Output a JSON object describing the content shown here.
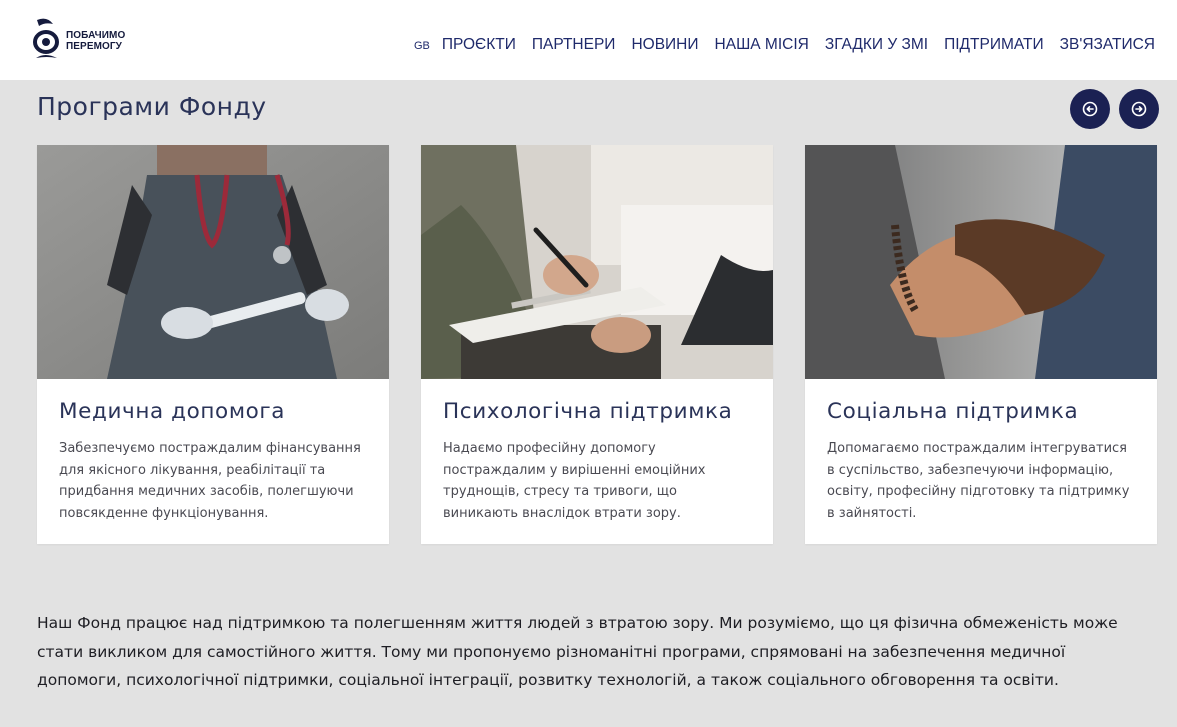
{
  "header": {
    "logo_text_line1": "ПОБАЧИМО",
    "logo_text_line2": "ПЕРЕМОГУ",
    "lang": "GB",
    "nav": [
      {
        "label": "ПРОЄКТИ"
      },
      {
        "label": "ПАРТНЕРИ"
      },
      {
        "label": "НОВИНИ"
      },
      {
        "label": "НАША МІСІЯ"
      },
      {
        "label": "ЗГАДКИ У ЗМІ"
      },
      {
        "label": "ПІДТРИМАТИ"
      },
      {
        "label": "ЗВ'ЯЗАТИСЯ"
      }
    ]
  },
  "section": {
    "title": "Програми Фонду",
    "prev_icon": "arrow-left-circle-icon",
    "next_icon": "arrow-right-circle-icon"
  },
  "cards": [
    {
      "title": "Медична допомога",
      "text": "Забезпечуємо постраждалим фінансування для якісного лікування, реабілітації та придбання медичних засобів, полегшуючи повсякденне функціонування.",
      "image": "doctor-with-stethoscope-photo"
    },
    {
      "title": "Психологічна підтримка",
      "text": "Надаємо професійну допомогу постраждалим у вирішенні емоційних труднощів, стресу та тривоги, що виникають внаслідок втрати зору.",
      "image": "therapist-writing-notes-photo"
    },
    {
      "title": "Соціальна підтримка",
      "text": "Допомагаємо постраждалим інтегруватися в суспільство, забезпечуючи інформацію, освіту, професійну підготовку та підтримку в зайнятості.",
      "image": "handshake-photo"
    }
  ],
  "intro": "Наш Фонд працює над підтримкою та полегшенням життя людей з втратою зору. Ми розуміємо, що ця фізична обмеженість може стати викликом для самостійного життя. Тому ми пропонуємо різноманітні програми, спрямовані на забезпечення медичної допомоги, психологічної підтримки, соціальної інтеграції, розвитку технологій, а також соціального обговорення та освіти.",
  "colors": {
    "navy": "#1b2153",
    "background": "#e2e2e2",
    "card": "#ffffff"
  }
}
